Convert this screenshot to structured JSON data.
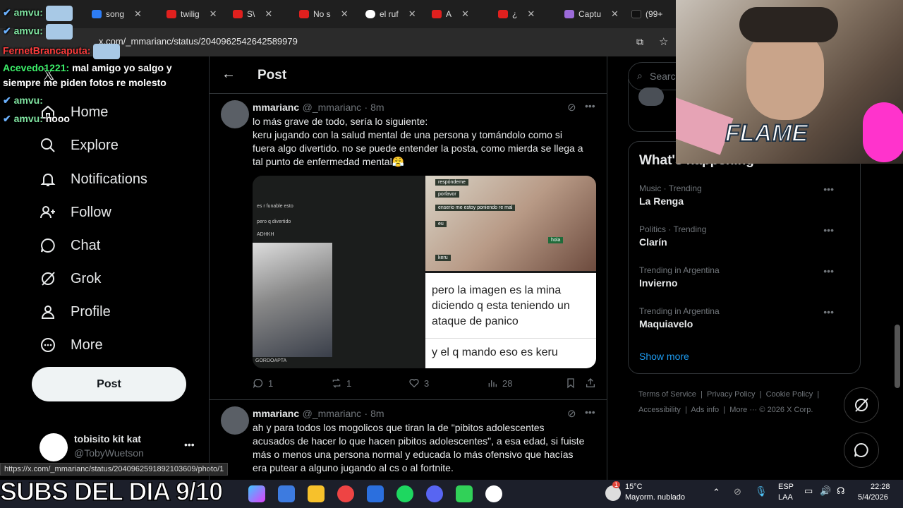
{
  "browser": {
    "tabs": [
      {
        "label": "song"
      },
      {
        "label": "twilig"
      },
      {
        "label": "S\\"
      },
      {
        "label": "No s"
      },
      {
        "label": "el ruf"
      },
      {
        "label": "A"
      },
      {
        "label": "¿"
      },
      {
        "label": "Captu"
      },
      {
        "label": "(99+"
      }
    ],
    "url": "x.com/_mmarianc/status/2040962542642589979",
    "status_url": "https://x.com/_mmarianc/status/2040962591892103609/photo/1"
  },
  "chat": {
    "messages": [
      {
        "user": "amvu:",
        "text": ""
      },
      {
        "user": "amvu:",
        "text": ""
      },
      {
        "user": "FernetBrancaputa:",
        "text": ""
      },
      {
        "user": "Acevedo1221:",
        "text": "mal amigo yo salgo y"
      },
      {
        "user": "",
        "text": "siempre me piden fotos re molesto"
      },
      {
        "user": "amvu:",
        "text": ""
      },
      {
        "user": "amvu:",
        "text": "nooo"
      }
    ]
  },
  "nav": {
    "items": [
      {
        "label": "Home",
        "icon": "home-icon"
      },
      {
        "label": "Explore",
        "icon": "search-icon"
      },
      {
        "label": "Notifications",
        "icon": "bell-icon"
      },
      {
        "label": "Follow",
        "icon": "follow-icon"
      },
      {
        "label": "Chat",
        "icon": "chat-icon"
      },
      {
        "label": "Grok",
        "icon": "grok-icon"
      },
      {
        "label": "Profile",
        "icon": "profile-icon"
      },
      {
        "label": "More",
        "icon": "more-icon"
      }
    ],
    "post_label": "Post",
    "account": {
      "name": "tobisito kit kat",
      "handle": "@TobyWuetson"
    }
  },
  "main": {
    "header_title": "Post",
    "tweets": [
      {
        "name": "mmarianc",
        "handle": "@_mmarianc",
        "time": "· 8m",
        "lines": [
          "lo más grave de todo, sería lo siguiente:",
          "keru jugando con la salud mental de una persona y tomándolo como si",
          "fuera algo divertido. no se puede entender la posta, como mierda se llega a",
          "tal punto de enfermedad mental😤"
        ],
        "image_right_text": {
          "line1": "pero la imagen es la mina",
          "line2": "diciendo q esta teniendo un",
          "line3": "ataque de panico",
          "line4": "y el q mando eso es keru"
        },
        "image_left_text": {
          "funable": "es r funable esto",
          "divertido": "pero q divertido",
          "adhkh": "ADHKH",
          "gordo": "GORDOAPTA"
        },
        "image_right_chat": {
          "msg1": "respóndeme",
          "msg2": "porfavor",
          "msg3": "enserio me estoy poniendo re mal",
          "msg4": "eu",
          "msg5": "hola",
          "msg6": "keru"
        },
        "stats": {
          "replies": "1",
          "reposts": "1",
          "likes": "3",
          "views": "28"
        }
      },
      {
        "name": "mmarianc",
        "handle": "@_mmarianc",
        "time": "· 8m",
        "lines": [
          "ah y para todos los mogolicos que tiran la de \"pibitos adolescentes",
          "acusados de hacer lo que hacen pibitos adolescentes\", a esa edad, si fuiste",
          "más o menos una persona normal y educada lo más ofensivo que hacías",
          "era putear a alguno jugando al cs o al fortnite."
        ]
      }
    ]
  },
  "sidebar": {
    "search_placeholder": "Searc",
    "trends_title": "What's happening",
    "trends": [
      {
        "category": "Music · Trending",
        "name": "La Renga"
      },
      {
        "category": "Politics · Trending",
        "name": "Clarín"
      },
      {
        "category": "Trending in Argentina",
        "name": "Invierno"
      },
      {
        "category": "Trending in Argentina",
        "name": "Maquiavelo"
      }
    ],
    "show_more": "Show more",
    "footer": {
      "terms": "Terms of Service",
      "privacy": "Privacy Policy",
      "cookie": "Cookie Policy",
      "accessibility": "Accessibility",
      "ads": "Ads info",
      "more": "More ···",
      "copyright": "© 2026 X Corp."
    }
  },
  "overlay": {
    "subs": "SUBS DEL DIA 9/10",
    "flame": "FLAME"
  },
  "taskbar": {
    "weather_temp": "15°C",
    "weather_desc": "Mayorm. nublado",
    "lang": "ESP",
    "lang2": "LAA",
    "time": "22:28",
    "date": "5/4/2026",
    "notif_count": "1"
  },
  "colors": {
    "accent": "#1d9bf0",
    "bg": "#000000",
    "muted": "#71767b",
    "text": "#e7e9ea"
  }
}
